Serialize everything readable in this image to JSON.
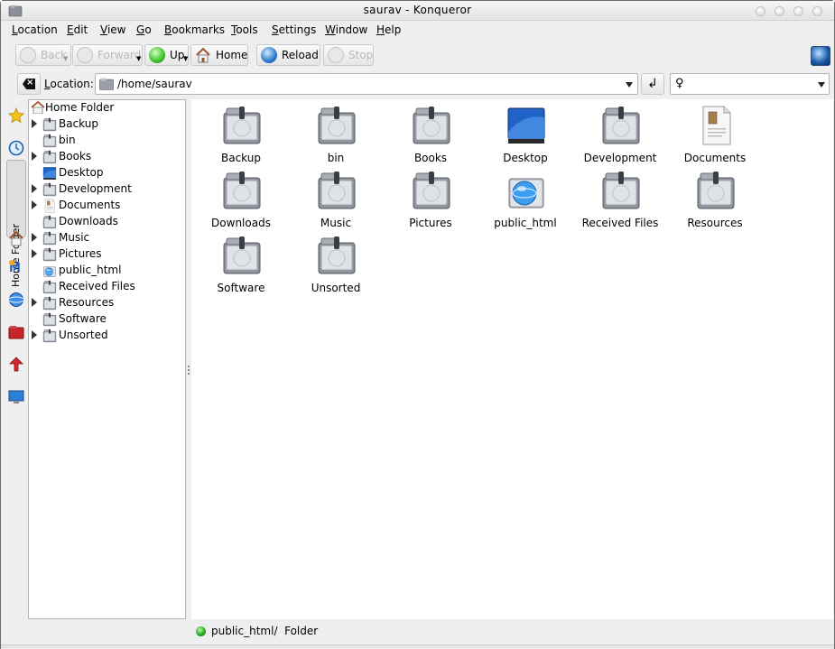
{
  "window": {
    "title": "saurav - Konqueror"
  },
  "menubar": [
    {
      "key": "L",
      "rest": "ocation"
    },
    {
      "key": "E",
      "rest": "dit"
    },
    {
      "key": "V",
      "rest": "iew"
    },
    {
      "key": "G",
      "rest": "o"
    },
    {
      "key": "B",
      "rest": "ookmarks"
    },
    {
      "key": "T",
      "rest": "ools"
    },
    {
      "key": "S",
      "rest": "ettings"
    },
    {
      "key": "W",
      "rest": "indow"
    },
    {
      "key": "H",
      "rest": "elp"
    }
  ],
  "toolbar": {
    "back": "Back",
    "forward": "Forward",
    "up": "Up",
    "home": "Home",
    "reload": "Reload",
    "stop": "Stop"
  },
  "location": {
    "label_key": "L",
    "label_rest": "ocation:",
    "value": "/home/saurav",
    "search_value": ""
  },
  "sidebar": {
    "active_tab": "Home Folder",
    "tabs": [
      "bookmarks-icon",
      "history-icon",
      "home-folder-icon",
      "media-icon",
      "network-icon",
      "root-folder-icon",
      "services-icon",
      "desktop-icon"
    ]
  },
  "tree": {
    "root": "Home Folder",
    "items": [
      {
        "label": "Backup",
        "expandable": true,
        "icon": "folder-icon"
      },
      {
        "label": "bin",
        "expandable": false,
        "icon": "folder-icon"
      },
      {
        "label": "Books",
        "expandable": true,
        "icon": "folder-icon"
      },
      {
        "label": "Desktop",
        "expandable": false,
        "icon": "desktop-folder-icon"
      },
      {
        "label": "Development",
        "expandable": true,
        "icon": "folder-icon"
      },
      {
        "label": "Documents",
        "expandable": true,
        "icon": "documents-icon"
      },
      {
        "label": "Downloads",
        "expandable": false,
        "icon": "folder-icon"
      },
      {
        "label": "Music",
        "expandable": true,
        "icon": "folder-icon"
      },
      {
        "label": "Pictures",
        "expandable": true,
        "icon": "folder-icon"
      },
      {
        "label": "public_html",
        "expandable": false,
        "icon": "web-folder-icon"
      },
      {
        "label": "Received Files",
        "expandable": false,
        "icon": "folder-icon"
      },
      {
        "label": "Resources",
        "expandable": true,
        "icon": "folder-icon"
      },
      {
        "label": "Software",
        "expandable": false,
        "icon": "folder-icon"
      },
      {
        "label": "Unsorted",
        "expandable": true,
        "icon": "folder-icon"
      }
    ]
  },
  "files": [
    {
      "label": "Backup",
      "icon": "folder-icon"
    },
    {
      "label": "bin",
      "icon": "folder-icon"
    },
    {
      "label": "Books",
      "icon": "folder-icon"
    },
    {
      "label": "Desktop",
      "icon": "desktop-folder-icon"
    },
    {
      "label": "Development",
      "icon": "folder-icon"
    },
    {
      "label": "Documents",
      "icon": "documents-icon"
    },
    {
      "label": "Downloads",
      "icon": "folder-icon"
    },
    {
      "label": "Music",
      "icon": "folder-icon"
    },
    {
      "label": "Pictures",
      "icon": "folder-icon"
    },
    {
      "label": "public_html",
      "icon": "web-folder-icon"
    },
    {
      "label": "Received Files",
      "icon": "folder-icon"
    },
    {
      "label": "Resources",
      "icon": "folder-icon"
    },
    {
      "label": "Software",
      "icon": "folder-icon"
    },
    {
      "label": "Unsorted",
      "icon": "folder-icon"
    }
  ],
  "status": {
    "text": "public_html/  Folder"
  },
  "colors": {
    "folder_body": "#9a9ea6",
    "folder_light": "#dfe2e7",
    "desktop_blue": "#1f62c8",
    "status_led": "#1ea51a"
  }
}
